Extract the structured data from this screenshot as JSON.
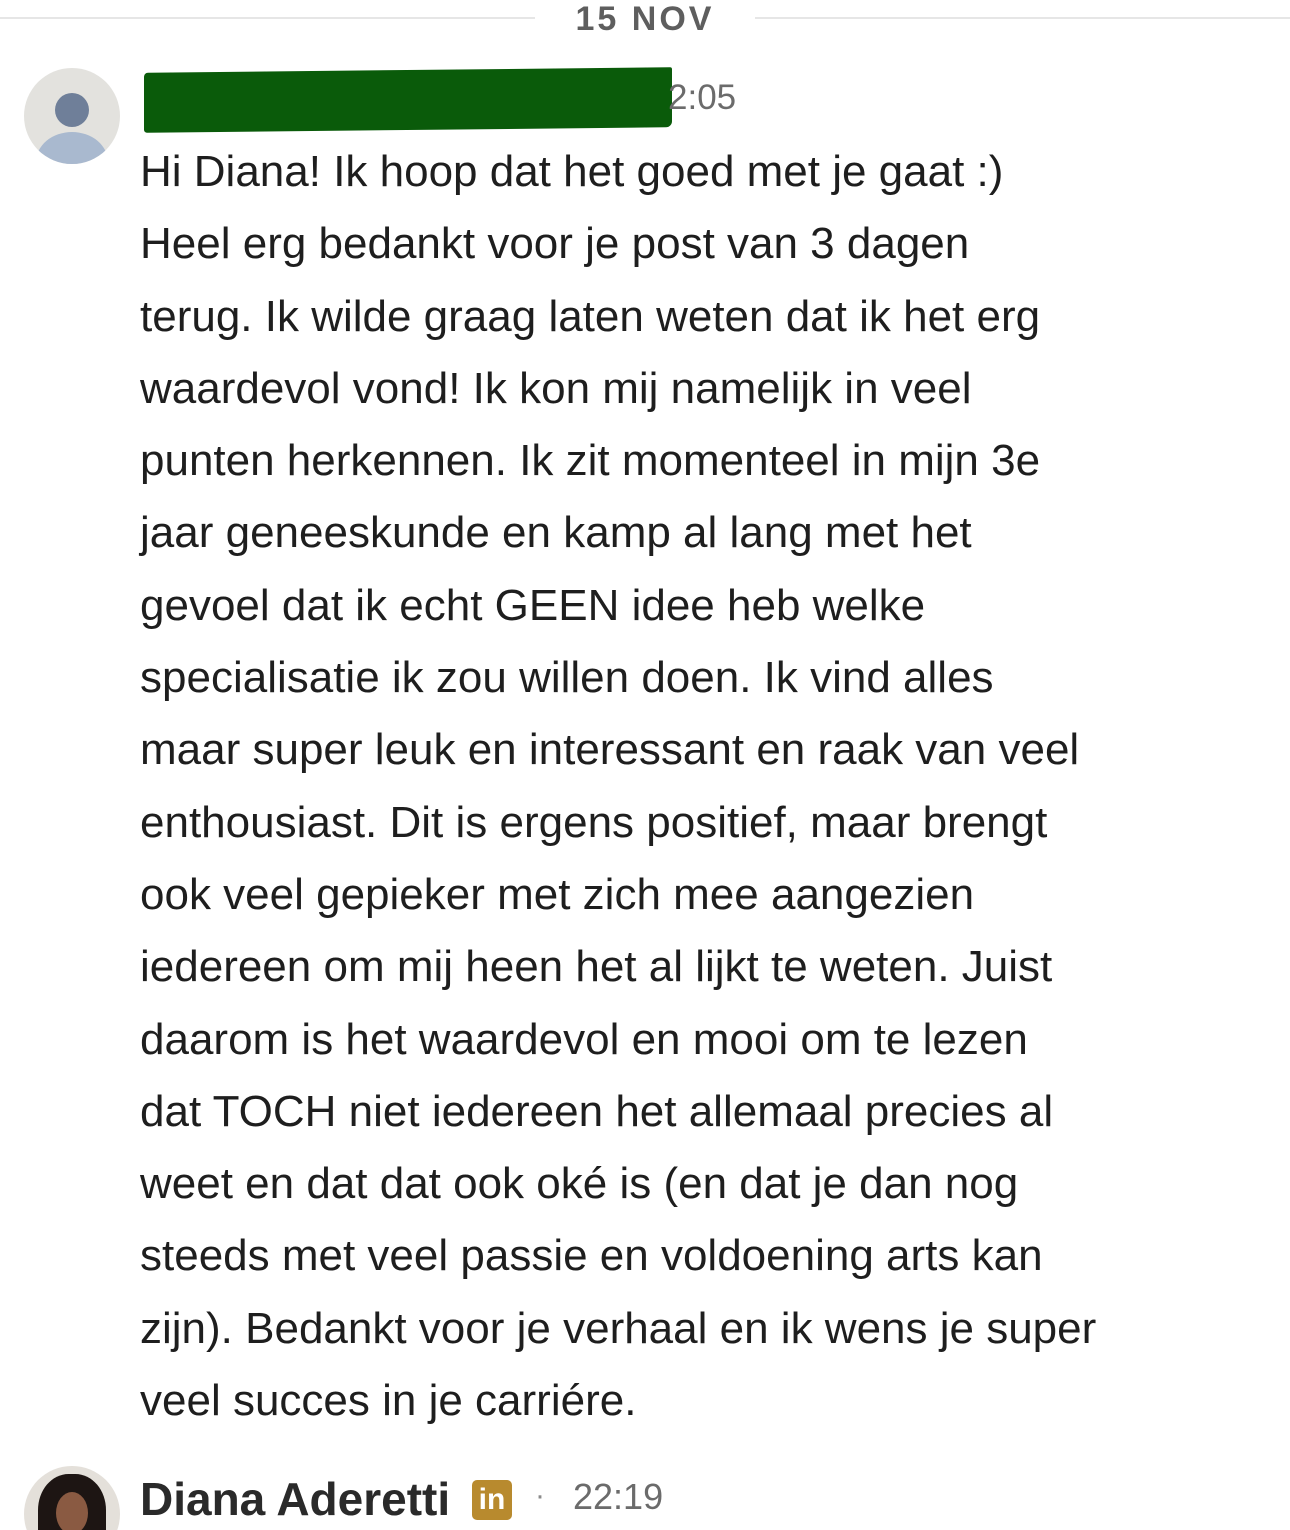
{
  "date_divider": "15 NOV",
  "messages": [
    {
      "sender_visible_fragment": "",
      "time": "2:05",
      "redacted": true,
      "lines": [
        "Hi Diana! Ik hoop dat het goed met je gaat :)",
        "Heel erg bedankt voor je post van 3 dagen",
        "terug. Ik wilde graag laten weten dat ik het erg",
        "waardevol vond! Ik kon mij namelijk in veel",
        "punten herkennen. Ik zit momenteel in mijn 3e",
        "jaar geneeskunde en kamp al lang met het",
        "gevoel dat ik echt GEEN idee heb welke",
        "specialisatie ik zou willen doen. Ik vind alles",
        "maar super leuk en interessant en raak van veel",
        "enthousiast. Dit is ergens positief, maar brengt",
        "ook veel gepieker met zich mee aangezien",
        "iedereen om mij heen het al lijkt te weten. Juist",
        "daarom is het waardevol en mooi om te lezen",
        "dat TOCH niet iedereen het allemaal precies al",
        "weet en dat dat ook oké is (en dat je dan nog",
        "steeds met veel passie en voldoening arts kan",
        "zijn). Bedankt voor je verhaal en ik wens je super",
        "veel succes in je carriére."
      ]
    },
    {
      "sender": "Diana Aderetti",
      "badge": "in",
      "separator": "·",
      "time": "22:19"
    }
  ]
}
